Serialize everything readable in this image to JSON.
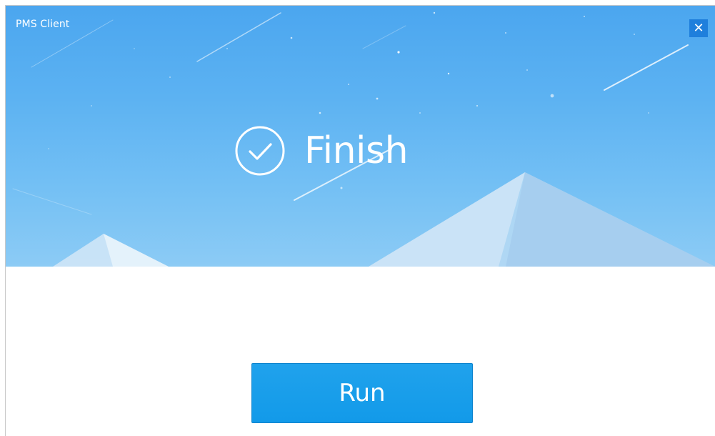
{
  "window": {
    "title": "PMS Client",
    "close_label": "✕"
  },
  "status": {
    "label": "Finish",
    "icon": "check-circle-icon"
  },
  "actions": {
    "run_label": "Run"
  },
  "colors": {
    "banner_top": "#4ba6ef",
    "banner_bottom": "#8ccbf5",
    "close_button": "#1f7fdc",
    "run_button": "#129ae9",
    "text_on_banner": "#ffffff"
  }
}
